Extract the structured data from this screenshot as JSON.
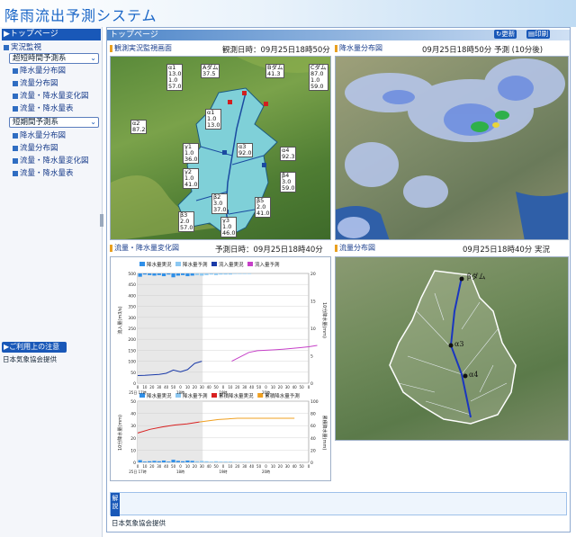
{
  "app": {
    "title": "降雨流出予測システム"
  },
  "sidebar": {
    "top_label": "▶トップページ",
    "section_observed": "実況監視",
    "select_very_short": "超短時間予測系",
    "very_short_items": [
      "降水量分布図",
      "流量分布図",
      "流量・降水量変化図",
      "流量・降水量表"
    ],
    "select_short": "短期間予測系",
    "short_items": [
      "降水量分布図",
      "流量分布図",
      "流量・降水量変化図",
      "流量・降水量表"
    ],
    "notice_label": "▶ご利用上の注意",
    "source": "日本気象協会提供"
  },
  "main": {
    "header_label": "トップページ",
    "refresh_label": "更新",
    "print_label": "印刷",
    "panel_monitor": {
      "title": "観測実況監視画面",
      "time": "観測日時：09月25日18時50分"
    },
    "panel_rain_map": {
      "title": "降水量分布図",
      "time": "09月25日18時50分 予測 (10分後)"
    },
    "panel_change": {
      "title": "流量・降水量変化図",
      "time": "予測日時：09月25日18時40分"
    },
    "panel_flow_map": {
      "title": "流量分布図",
      "time": "09月25日18時40分 実況"
    },
    "explain_tag": "解説",
    "source": "日本気象協会提供"
  },
  "monitor_boxes": [
    {
      "name": "α1",
      "l1": "13.0",
      "l2": "1.0",
      "l3": "57.0"
    },
    {
      "name": "Aダム",
      "l1": "37.5",
      "l2": "",
      "l3": ""
    },
    {
      "name": "Bダム",
      "l1": "41.3",
      "l2": "",
      "l3": ""
    },
    {
      "name": "Cダム",
      "l1": "87.0",
      "l2": "1.0",
      "l3": "59.0"
    },
    {
      "name": "α2",
      "l1": "87.2",
      "l2": "",
      "l3": ""
    },
    {
      "name": "α1",
      "l1": "1.0",
      "l2": "13.0",
      "l3": ""
    },
    {
      "name": "γ1",
      "l1": "1.0",
      "l2": "36.0",
      "l3": ""
    },
    {
      "name": "α3",
      "l1": "92.0",
      "l2": "",
      "l3": ""
    },
    {
      "name": "α4",
      "l1": "92.3",
      "l2": "",
      "l3": ""
    },
    {
      "name": "γ2",
      "l1": "1.0",
      "l2": "41.0",
      "l3": ""
    },
    {
      "name": "β4",
      "l1": "3.0",
      "l2": "59.0",
      "l3": ""
    },
    {
      "name": "β2",
      "l1": "3.0",
      "l2": "37.0",
      "l3": ""
    },
    {
      "name": "β5",
      "l1": "2.0",
      "l2": "41.0",
      "l3": ""
    },
    {
      "name": "β3",
      "l1": "2.0",
      "l2": "57.0",
      "l3": ""
    },
    {
      "name": "γ3",
      "l1": "1.0",
      "l2": "46.0",
      "l3": ""
    }
  ],
  "flow_map_labels": [
    "βダム",
    "α3",
    "α4"
  ],
  "chart_data": [
    {
      "type": "line",
      "title": "",
      "legend": [
        "降水量実況",
        "降水量予測",
        "流入量実況",
        "流入量予測"
      ],
      "ylabel_left": "流入量(m3/s)",
      "ylabel_right": "10分降水量(mm)",
      "ylim_left": [
        0,
        500
      ],
      "ylim_right": [
        0,
        10
      ],
      "y_ticks_left": [
        0,
        50,
        100,
        150,
        200,
        250,
        300,
        350,
        400,
        450,
        500
      ],
      "y_ticks_right": [
        20,
        15,
        10,
        5,
        0
      ],
      "x_ticks": [
        "0",
        "10",
        "20",
        "30",
        "40",
        "50",
        "0",
        "10",
        "20",
        "30",
        "40",
        "50",
        "0",
        "10",
        "20",
        "30",
        "40",
        "50",
        "0",
        "10",
        "20",
        "30",
        "40",
        "50",
        "0"
      ],
      "x_day_labels": [
        "25日 17時",
        "18時",
        "19時",
        "20時"
      ],
      "rain_observed": [
        0.6,
        0.2,
        0.3,
        0.4,
        0.3,
        0.5,
        0.2,
        0.7,
        0.4,
        0.3,
        0.5,
        0.4
      ],
      "rain_forecast": [
        0.3,
        0.4,
        0.3,
        0.2,
        0.3,
        0.2,
        0.2,
        0.2,
        0.1,
        0.1,
        0.1,
        0.1,
        0.0
      ],
      "series": [
        {
          "name": "流入量実況",
          "values": [
            35,
            36,
            38,
            40,
            45,
            60,
            52,
            62,
            90,
            100
          ]
        },
        {
          "name": "流入量予測",
          "values": [
            100,
            120,
            140,
            148,
            150,
            152,
            155,
            158,
            162,
            166,
            172
          ]
        }
      ]
    },
    {
      "type": "line",
      "title": "",
      "legend": [
        "降水量実況",
        "降水量予測",
        "累積降水量実況",
        "累積降水量予測"
      ],
      "ylabel_left": "10分降水量(mm)",
      "ylabel_right": "累積降水量(mm)",
      "ylim_left": [
        0,
        50
      ],
      "ylim_right": [
        0,
        100
      ],
      "y_ticks_left": [
        0,
        10,
        20,
        30,
        40,
        50
      ],
      "y_ticks_right": [
        0,
        20,
        40,
        60,
        80,
        100
      ],
      "series": [
        {
          "name": "累積降水量実況",
          "values": [
            48,
            54,
            58,
            61,
            63,
            66
          ]
        },
        {
          "name": "累積降水量予測",
          "values": [
            66,
            68,
            70,
            71,
            72,
            72,
            72,
            72,
            72,
            72,
            72
          ]
        }
      ]
    }
  ]
}
